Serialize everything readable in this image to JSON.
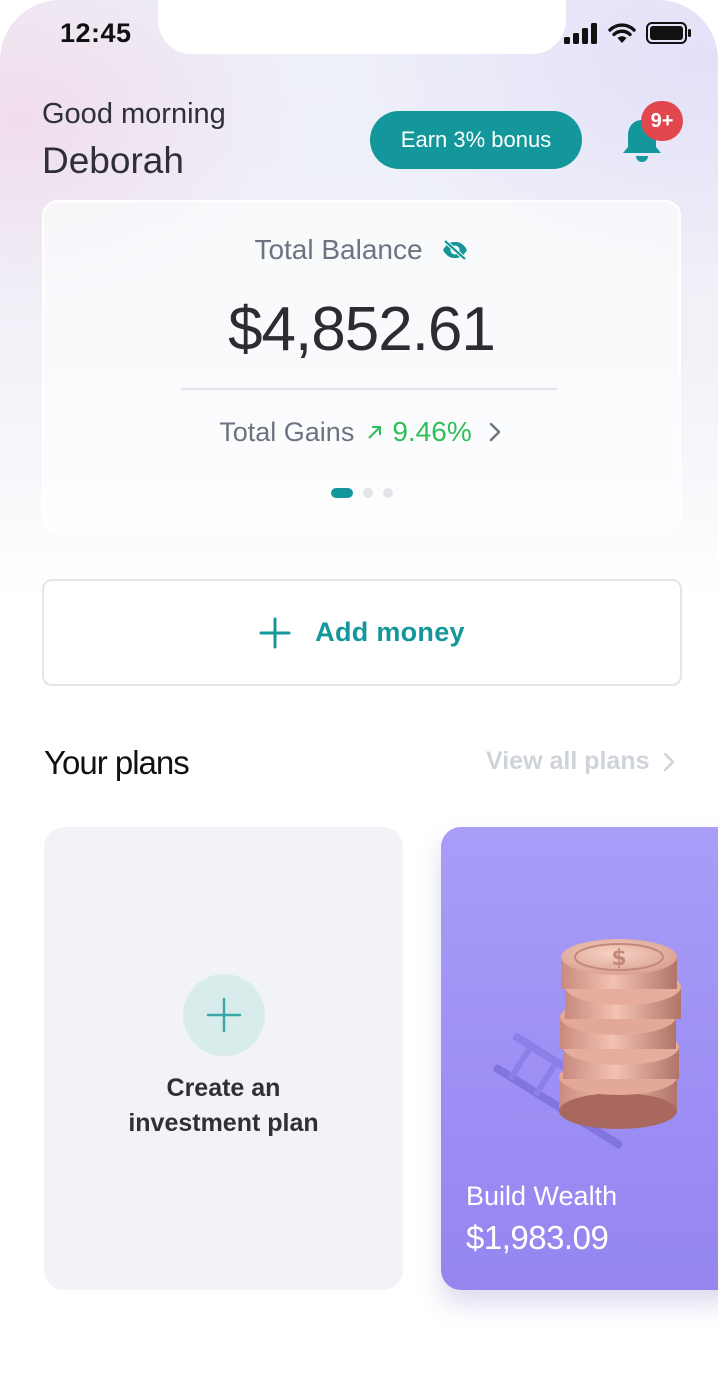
{
  "status_bar": {
    "time": "12:45"
  },
  "header": {
    "greeting": "Good morning",
    "username": "Deborah",
    "bonus_button": "Earn 3% bonus",
    "notification_count": "9+"
  },
  "balance_card": {
    "label": "Total Balance",
    "amount": "$4,852.61",
    "gains_label": "Total Gains",
    "gains_value": "9.46%",
    "pager": {
      "pages": 3,
      "active": 1
    }
  },
  "add_money": {
    "label": "Add money"
  },
  "plans": {
    "title": "Your plans",
    "view_all": "View all plans",
    "create_card": {
      "line1": "Create an",
      "line2": "investment plan"
    },
    "cards": [
      {
        "name": "Build Wealth",
        "amount": "$1,983.09"
      }
    ]
  },
  "colors": {
    "accent": "#14979a",
    "gain": "#2fbf5b",
    "badge": "#e2474e",
    "plan_card": "#9d8ff4"
  },
  "icons": [
    "signal-icon",
    "wifi-icon",
    "battery-icon",
    "bell-icon",
    "eye-slash-icon",
    "arrow-up-right-icon",
    "chevron-right-icon",
    "plus-icon",
    "coin-stack-illustration"
  ]
}
